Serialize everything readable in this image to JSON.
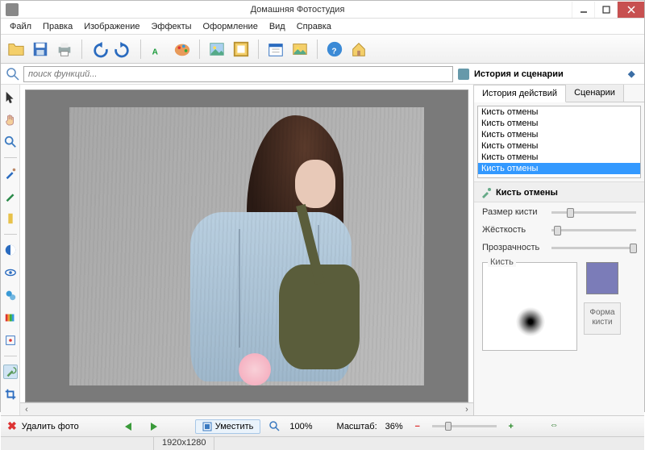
{
  "title": "Домашняя Фотостудия",
  "menu": [
    "Файл",
    "Правка",
    "Изображение",
    "Эффекты",
    "Оформление",
    "Вид",
    "Справка"
  ],
  "toolbar": [
    {
      "name": "folder-open-icon",
      "color": "#e8c24a"
    },
    {
      "name": "save-icon",
      "color": "#2a6bbf"
    },
    {
      "name": "print-icon",
      "color": "#7b8a99"
    },
    {
      "name": "sep"
    },
    {
      "name": "undo-icon",
      "color": "#2a6bbf"
    },
    {
      "name": "redo-icon",
      "color": "#2a6bbf"
    },
    {
      "name": "sep"
    },
    {
      "name": "text-icon",
      "color": "#1a9a3a"
    },
    {
      "name": "palette-icon",
      "color": "#e88c2a"
    },
    {
      "name": "sep"
    },
    {
      "name": "image-icon",
      "color": "#6aa0d8"
    },
    {
      "name": "frame-icon",
      "color": "#e8b24a"
    },
    {
      "name": "sep"
    },
    {
      "name": "calendar-icon",
      "color": "#2a6bbf"
    },
    {
      "name": "postcard-icon",
      "color": "#e8b24a"
    },
    {
      "name": "sep"
    },
    {
      "name": "help-icon",
      "color": "#2a7bcf"
    },
    {
      "name": "home-icon",
      "color": "#e8b24a"
    }
  ],
  "search": {
    "placeholder": "поиск функций..."
  },
  "right": {
    "header": "История и сценарии",
    "tabs": [
      "История действий",
      "Сценарии"
    ],
    "history": [
      "Кисть отмены",
      "Кисть отмены",
      "Кисть отмены",
      "Кисть отмены",
      "Кисть отмены",
      "Кисть отмены"
    ],
    "history_selected": 5,
    "section_title": "Кисть отмены",
    "props": {
      "size_label": "Размер кисти",
      "hardness_label": "Жёсткость",
      "opacity_label": "Прозрачность"
    },
    "brush_label": "Кисть",
    "shape_label": "Форма\nкисти",
    "color": "#7b7cb8"
  },
  "left_tools": [
    {
      "name": "cursor-icon"
    },
    {
      "name": "hand-icon"
    },
    {
      "name": "zoom-icon"
    },
    {
      "name": "sep"
    },
    {
      "name": "brush-icon"
    },
    {
      "name": "pencil-icon"
    },
    {
      "name": "marker-icon"
    },
    {
      "name": "sep"
    },
    {
      "name": "contrast-icon"
    },
    {
      "name": "eye-icon"
    },
    {
      "name": "clone-icon"
    },
    {
      "name": "gradient-icon"
    },
    {
      "name": "adjust-icon"
    },
    {
      "name": "sep"
    },
    {
      "name": "undo-brush-icon",
      "active": true
    },
    {
      "name": "crop-icon"
    }
  ],
  "status": {
    "delete_label": "Удалить фото",
    "fit_label": "Уместить",
    "zoom_100": "100%",
    "scale_label": "Масштаб:",
    "scale_value": "36%"
  },
  "dims": "1920x1280"
}
